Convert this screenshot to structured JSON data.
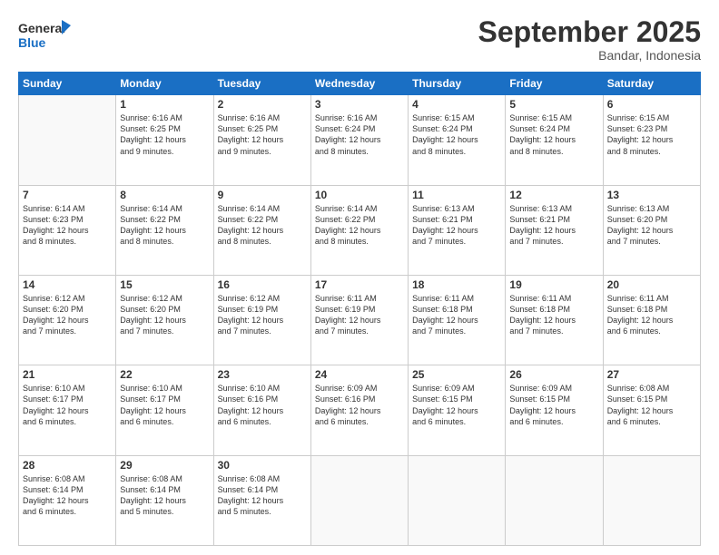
{
  "logo": {
    "line1": "General",
    "line2": "Blue"
  },
  "title": "September 2025",
  "subtitle": "Bandar, Indonesia",
  "days_header": [
    "Sunday",
    "Monday",
    "Tuesday",
    "Wednesday",
    "Thursday",
    "Friday",
    "Saturday"
  ],
  "weeks": [
    [
      {
        "num": "",
        "info": ""
      },
      {
        "num": "1",
        "info": "Sunrise: 6:16 AM\nSunset: 6:25 PM\nDaylight: 12 hours\nand 9 minutes."
      },
      {
        "num": "2",
        "info": "Sunrise: 6:16 AM\nSunset: 6:25 PM\nDaylight: 12 hours\nand 9 minutes."
      },
      {
        "num": "3",
        "info": "Sunrise: 6:16 AM\nSunset: 6:24 PM\nDaylight: 12 hours\nand 8 minutes."
      },
      {
        "num": "4",
        "info": "Sunrise: 6:15 AM\nSunset: 6:24 PM\nDaylight: 12 hours\nand 8 minutes."
      },
      {
        "num": "5",
        "info": "Sunrise: 6:15 AM\nSunset: 6:24 PM\nDaylight: 12 hours\nand 8 minutes."
      },
      {
        "num": "6",
        "info": "Sunrise: 6:15 AM\nSunset: 6:23 PM\nDaylight: 12 hours\nand 8 minutes."
      }
    ],
    [
      {
        "num": "7",
        "info": "Sunrise: 6:14 AM\nSunset: 6:23 PM\nDaylight: 12 hours\nand 8 minutes."
      },
      {
        "num": "8",
        "info": "Sunrise: 6:14 AM\nSunset: 6:22 PM\nDaylight: 12 hours\nand 8 minutes."
      },
      {
        "num": "9",
        "info": "Sunrise: 6:14 AM\nSunset: 6:22 PM\nDaylight: 12 hours\nand 8 minutes."
      },
      {
        "num": "10",
        "info": "Sunrise: 6:14 AM\nSunset: 6:22 PM\nDaylight: 12 hours\nand 8 minutes."
      },
      {
        "num": "11",
        "info": "Sunrise: 6:13 AM\nSunset: 6:21 PM\nDaylight: 12 hours\nand 7 minutes."
      },
      {
        "num": "12",
        "info": "Sunrise: 6:13 AM\nSunset: 6:21 PM\nDaylight: 12 hours\nand 7 minutes."
      },
      {
        "num": "13",
        "info": "Sunrise: 6:13 AM\nSunset: 6:20 PM\nDaylight: 12 hours\nand 7 minutes."
      }
    ],
    [
      {
        "num": "14",
        "info": "Sunrise: 6:12 AM\nSunset: 6:20 PM\nDaylight: 12 hours\nand 7 minutes."
      },
      {
        "num": "15",
        "info": "Sunrise: 6:12 AM\nSunset: 6:20 PM\nDaylight: 12 hours\nand 7 minutes."
      },
      {
        "num": "16",
        "info": "Sunrise: 6:12 AM\nSunset: 6:19 PM\nDaylight: 12 hours\nand 7 minutes."
      },
      {
        "num": "17",
        "info": "Sunrise: 6:11 AM\nSunset: 6:19 PM\nDaylight: 12 hours\nand 7 minutes."
      },
      {
        "num": "18",
        "info": "Sunrise: 6:11 AM\nSunset: 6:18 PM\nDaylight: 12 hours\nand 7 minutes."
      },
      {
        "num": "19",
        "info": "Sunrise: 6:11 AM\nSunset: 6:18 PM\nDaylight: 12 hours\nand 7 minutes."
      },
      {
        "num": "20",
        "info": "Sunrise: 6:11 AM\nSunset: 6:18 PM\nDaylight: 12 hours\nand 6 minutes."
      }
    ],
    [
      {
        "num": "21",
        "info": "Sunrise: 6:10 AM\nSunset: 6:17 PM\nDaylight: 12 hours\nand 6 minutes."
      },
      {
        "num": "22",
        "info": "Sunrise: 6:10 AM\nSunset: 6:17 PM\nDaylight: 12 hours\nand 6 minutes."
      },
      {
        "num": "23",
        "info": "Sunrise: 6:10 AM\nSunset: 6:16 PM\nDaylight: 12 hours\nand 6 minutes."
      },
      {
        "num": "24",
        "info": "Sunrise: 6:09 AM\nSunset: 6:16 PM\nDaylight: 12 hours\nand 6 minutes."
      },
      {
        "num": "25",
        "info": "Sunrise: 6:09 AM\nSunset: 6:15 PM\nDaylight: 12 hours\nand 6 minutes."
      },
      {
        "num": "26",
        "info": "Sunrise: 6:09 AM\nSunset: 6:15 PM\nDaylight: 12 hours\nand 6 minutes."
      },
      {
        "num": "27",
        "info": "Sunrise: 6:08 AM\nSunset: 6:15 PM\nDaylight: 12 hours\nand 6 minutes."
      }
    ],
    [
      {
        "num": "28",
        "info": "Sunrise: 6:08 AM\nSunset: 6:14 PM\nDaylight: 12 hours\nand 6 minutes."
      },
      {
        "num": "29",
        "info": "Sunrise: 6:08 AM\nSunset: 6:14 PM\nDaylight: 12 hours\nand 5 minutes."
      },
      {
        "num": "30",
        "info": "Sunrise: 6:08 AM\nSunset: 6:14 PM\nDaylight: 12 hours\nand 5 minutes."
      },
      {
        "num": "",
        "info": ""
      },
      {
        "num": "",
        "info": ""
      },
      {
        "num": "",
        "info": ""
      },
      {
        "num": "",
        "info": ""
      }
    ]
  ]
}
